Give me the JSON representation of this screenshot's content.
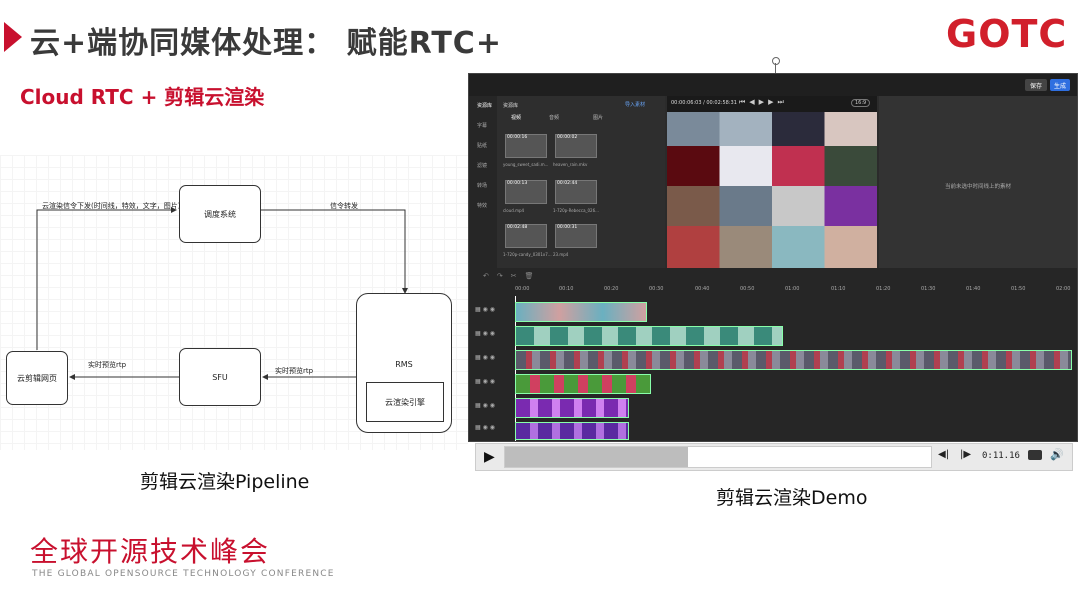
{
  "slide": {
    "title": "云+端协同媒体处理： 赋能RTC+",
    "logo": "GOTC",
    "subtitle": "Cloud RTC + 剪辑云渲染",
    "footer_cn": "全球开源技术峰会",
    "footer_en": "THE GLOBAL OPENSOURCE TECHNOLOGY CONFERENCE",
    "accent_color": "#c8102e"
  },
  "diagram": {
    "nodes": {
      "scheduler": "调度系统",
      "rms": "RMS",
      "render_engine": "云渲染引擎",
      "sfu": "SFU",
      "web_editor": "云剪辑网页"
    },
    "edges": {
      "signal_down": "云渲染信令下发(时间线，特效，文字，图片)",
      "signal_forward": "信令转发",
      "preview_rtp_1": "实时预览rtp",
      "preview_rtp_2": "实时预览rtp"
    },
    "caption": "剪辑云渲染Pipeline"
  },
  "demo": {
    "caption": "剪辑云渲染Demo",
    "buttons": {
      "save": "保存",
      "generate": "生成",
      "import": "导入素材"
    },
    "nav": [
      "资源库",
      "字幕",
      "贴纸",
      "滤镜",
      "转场",
      "特效"
    ],
    "lib_title": "资源库",
    "tabs": [
      "视频",
      "音频",
      "图片"
    ],
    "thumbs": [
      {
        "time": "00:00:16",
        "name": "young_sweet_sadi.m..."
      },
      {
        "time": "00:00:02",
        "name": "heaven_rain.mkv"
      },
      {
        "time": "00:00:13",
        "name": "cloud.mp4"
      },
      {
        "time": "00:02:44",
        "name": "1-720p-Rebecca_026..."
      },
      {
        "time": "00:02:48",
        "name": "1-720p-candy_0301x7..."
      },
      {
        "time": "00:00:31",
        "name": "23.mp4"
      }
    ],
    "timecode": "00:00:06:03 / 00:02:58:31",
    "ratio": "16:9",
    "side_empty": "当前未选中时间线上的素材",
    "ruler": [
      "00:00",
      "00:10",
      "00:20",
      "00:30",
      "00:40",
      "00:50",
      "01:00",
      "01:10",
      "01:20",
      "01:30",
      "01:40",
      "01:50",
      "02:00"
    ]
  },
  "player": {
    "time": "0:11.16",
    "progress": 0.43
  }
}
